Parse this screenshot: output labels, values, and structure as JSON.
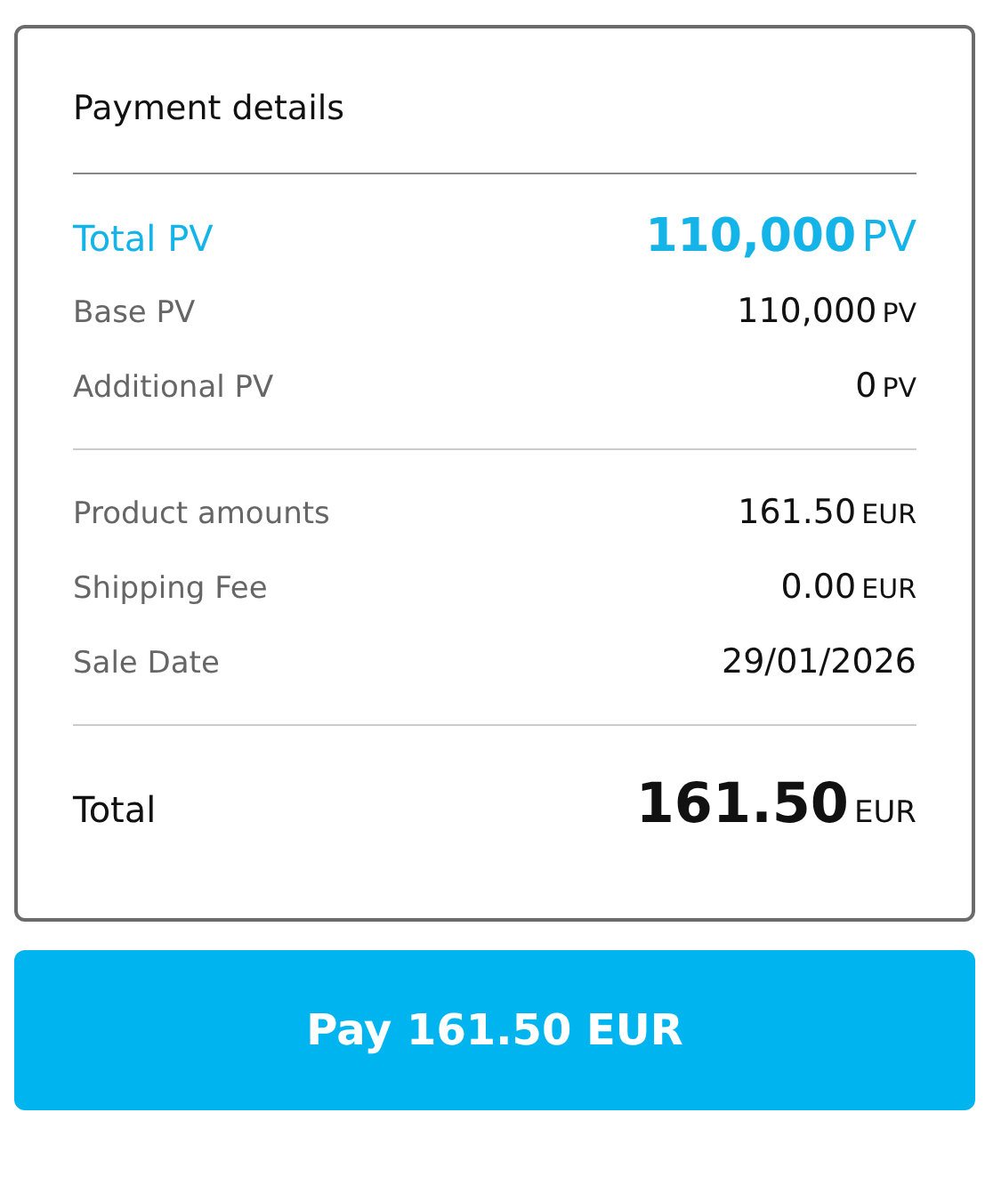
{
  "card": {
    "title": "Payment details",
    "sections": [
      {
        "rows": [
          {
            "kind": "highlight",
            "label": "Total PV",
            "value": "110,000",
            "unit": "PV"
          },
          {
            "kind": "normal",
            "label": "Base PV",
            "value": "110,000",
            "unit": "PV"
          },
          {
            "kind": "normal",
            "label": "Additional PV",
            "value": "0",
            "unit": "PV"
          }
        ]
      },
      {
        "rows": [
          {
            "kind": "normal",
            "label": "Product amounts",
            "value": "161.50",
            "unit": "EUR"
          },
          {
            "kind": "normal",
            "label": "Shipping Fee",
            "value": "0.00",
            "unit": "EUR"
          },
          {
            "kind": "normal",
            "label": "Sale Date",
            "value": "29/01/2026"
          }
        ]
      },
      {
        "rows": [
          {
            "kind": "total",
            "label": "Total",
            "value": "161.50",
            "unit": "EUR"
          }
        ]
      }
    ]
  },
  "pay_button": {
    "label": "Pay 161.50 EUR"
  }
}
